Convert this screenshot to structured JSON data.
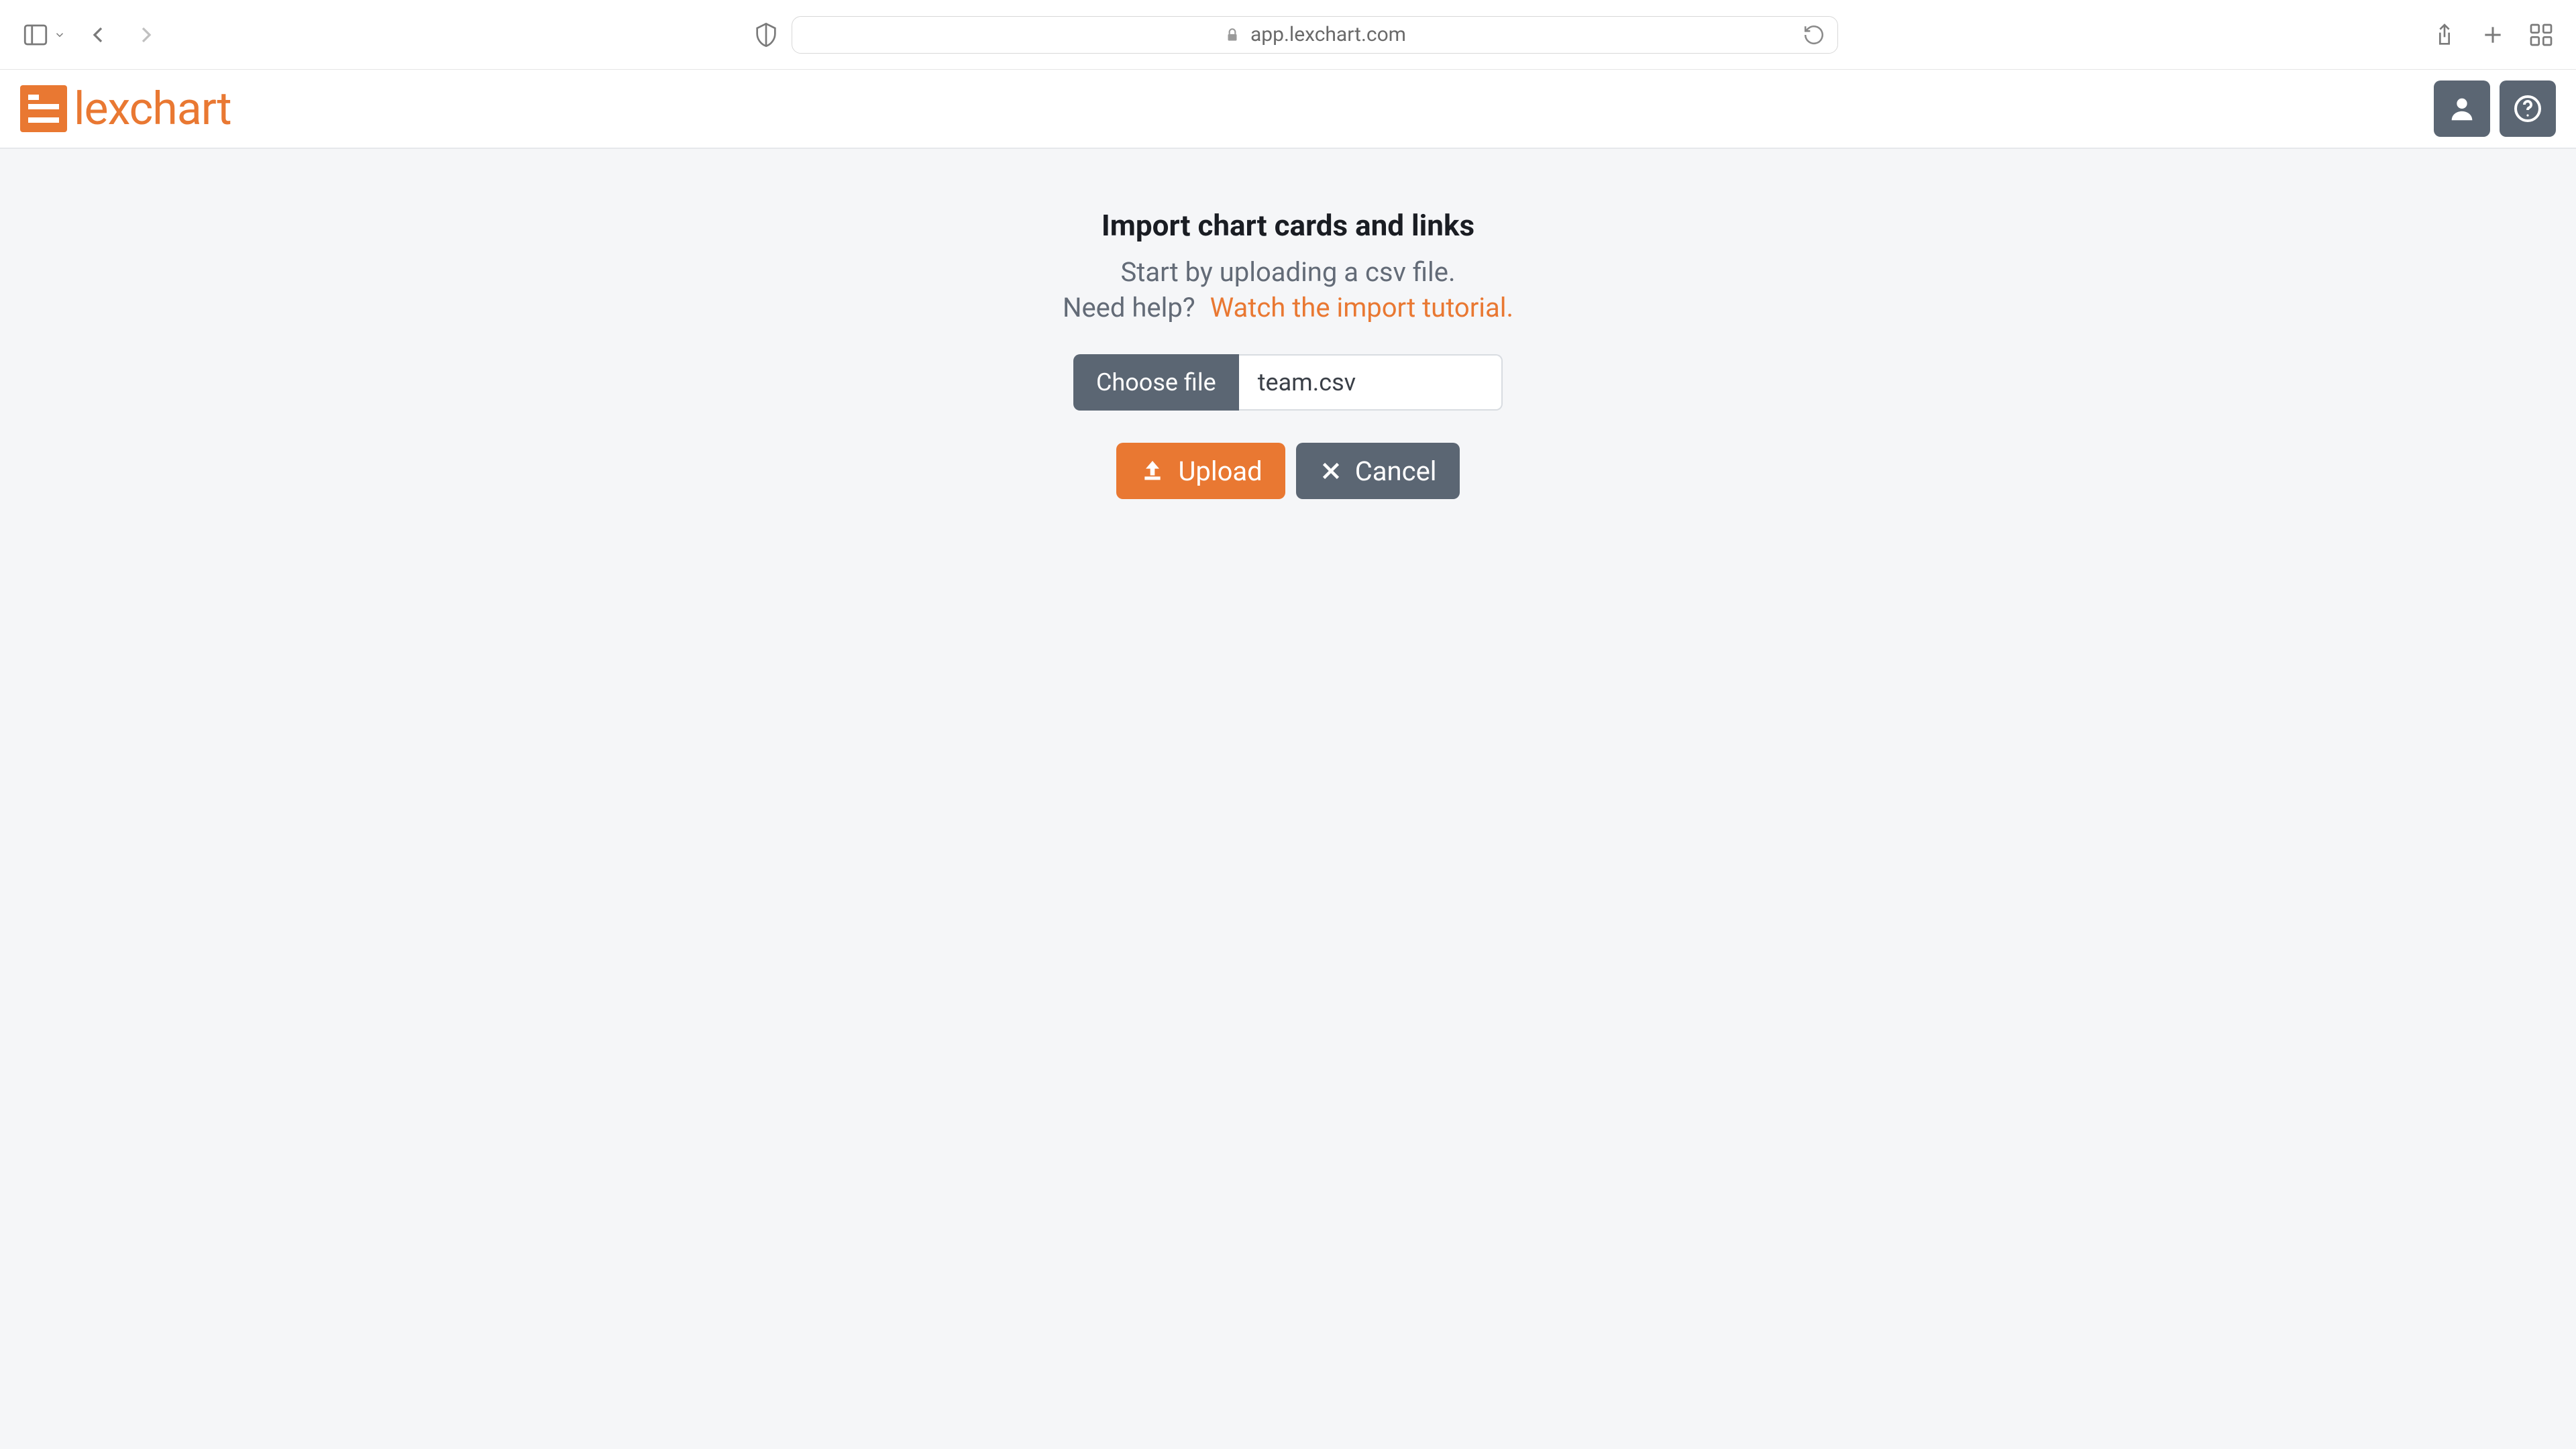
{
  "browser": {
    "url": "app.lexchart.com"
  },
  "brand": {
    "name": "lexchart"
  },
  "import": {
    "heading": "Import chart cards and links",
    "subtitle": "Start by uploading a csv file.",
    "help_prefix": "Need help?",
    "tutorial_link": "Watch the import tutorial.",
    "choose_label": "Choose file",
    "file_name": "team.csv",
    "upload_label": "Upload",
    "cancel_label": "Cancel"
  }
}
